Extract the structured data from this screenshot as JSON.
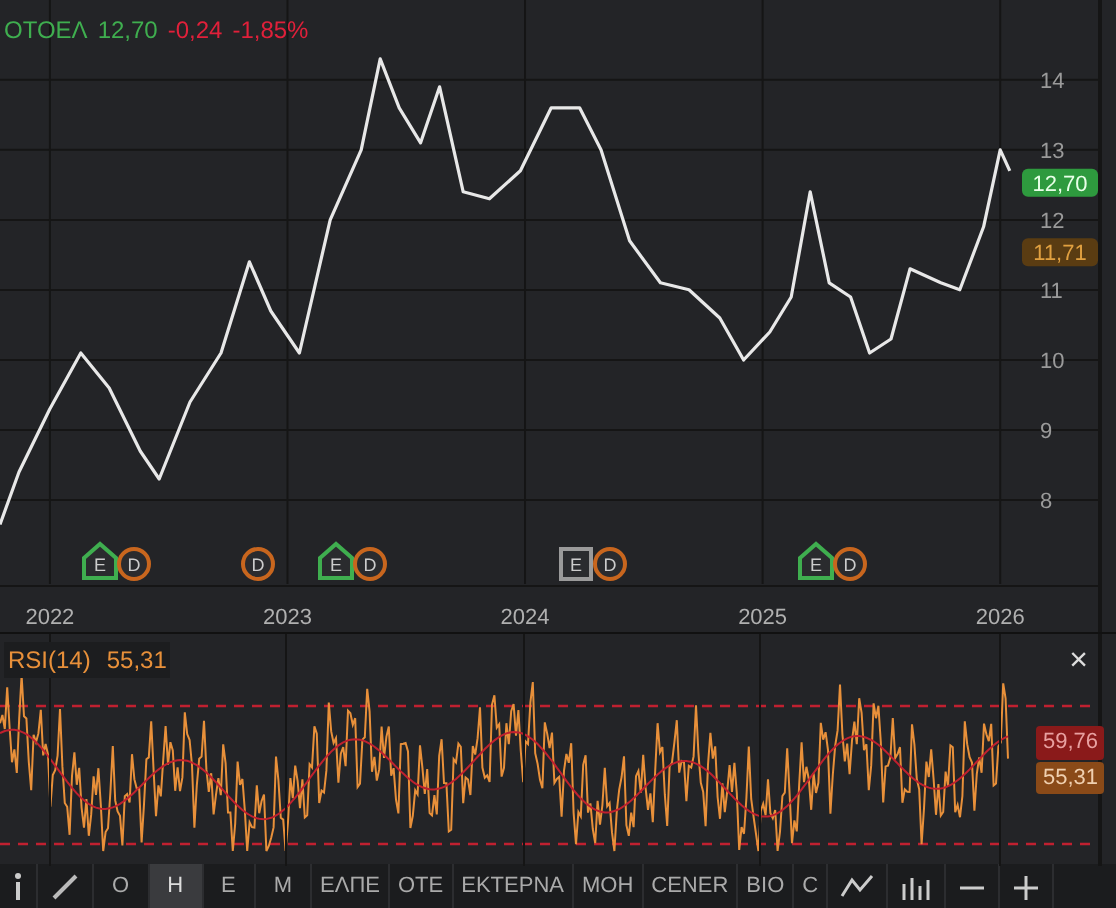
{
  "quote": {
    "symbol": "ΟΤΟΕΛ",
    "price": "12,70",
    "change": "-0,24",
    "change_percent": "-1,85%"
  },
  "price_chart": {
    "chart_data": {
      "type": "line",
      "ylim": [
        6.8,
        15.14
      ],
      "xticks": [
        {
          "value": 2022,
          "label": "2022"
        },
        {
          "value": 2023,
          "label": "2023"
        },
        {
          "value": 2024,
          "label": "2024"
        },
        {
          "value": 2025,
          "label": "2025"
        },
        {
          "value": 2026,
          "label": "2026"
        }
      ],
      "yticks": [
        8,
        9,
        10,
        11,
        12,
        13,
        14
      ],
      "x": [
        2021.79,
        2021.87,
        2022.0,
        2022.13,
        2022.25,
        2022.38,
        2022.46,
        2022.59,
        2022.72,
        2022.84,
        2022.93,
        2023.05,
        2023.18,
        2023.31,
        2023.39,
        2023.47,
        2023.56,
        2023.64,
        2023.74,
        2023.85,
        2023.98,
        2024.11,
        2024.23,
        2024.32,
        2024.44,
        2024.57,
        2024.69,
        2024.82,
        2024.92,
        2025.03,
        2025.12,
        2025.2,
        2025.28,
        2025.37,
        2025.45,
        2025.54,
        2025.62,
        2025.75,
        2025.83,
        2025.93,
        2026.0,
        2026.04
      ],
      "grid": true,
      "series": [
        {
          "color": "#e8e8e8",
          "values": [
            7.65,
            8.4,
            9.3,
            10.1,
            9.6,
            8.7,
            8.3,
            9.4,
            10.1,
            11.4,
            10.7,
            10.1,
            12.0,
            13.0,
            14.3,
            13.6,
            13.1,
            13.9,
            12.4,
            12.3,
            12.7,
            13.6,
            13.6,
            13.0,
            11.7,
            11.1,
            11.0,
            10.6,
            10.0,
            10.4,
            10.9,
            12.4,
            11.1,
            10.9,
            10.1,
            10.3,
            11.3,
            11.1,
            11.0,
            11.9,
            13.0,
            12.7
          ]
        }
      ],
      "xlim": [
        2021.79,
        2026.42
      ]
    },
    "event_markers": [
      {
        "text": "E",
        "kind": "earnings",
        "color": "#3fae4f"
      },
      {
        "text": "D",
        "kind": "dividend",
        "color": "#c8661e"
      },
      {
        "text": "D",
        "kind": "dividend",
        "color": "#c8661e"
      },
      {
        "text": "E",
        "kind": "earnings",
        "color": "#3fae4f"
      },
      {
        "text": "D",
        "kind": "dividend",
        "color": "#c8661e"
      },
      {
        "text": "E",
        "kind": "earnings",
        "color": "#9a9a9a"
      },
      {
        "text": "D",
        "kind": "dividend",
        "color": "#c8661e"
      },
      {
        "text": "E",
        "kind": "earnings",
        "color": "#3fae4f"
      },
      {
        "text": "D",
        "kind": "dividend",
        "color": "#c8661e"
      }
    ],
    "price_labels": [
      {
        "text": "12,70",
        "kind": "last"
      },
      {
        "text": "11,71",
        "kind": "average"
      }
    ]
  },
  "rsi_panel": {
    "title": "RSI(14)",
    "value": "55,31",
    "axis_labels": [
      {
        "text": "59,76",
        "kind": "signal"
      },
      {
        "text": "55,31",
        "kind": "rsi"
      }
    ],
    "close": "×"
  },
  "toolbar": {
    "periods": [
      {
        "label": "Ο",
        "selected": false
      },
      {
        "label": "Η",
        "selected": true
      },
      {
        "label": "Ε",
        "selected": false
      },
      {
        "label": "Μ",
        "selected": false
      }
    ],
    "symbols": [
      "ΕΛΠΕ",
      "ΟΤΕ",
      "ΕΚΤΕΡΝΑ",
      "ΜΟΗ",
      "CENER",
      "ΒΙΟ",
      "C"
    ]
  }
}
